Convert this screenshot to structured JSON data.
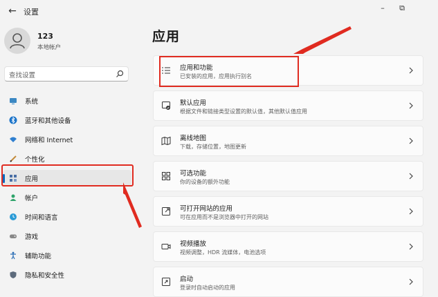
{
  "window": {
    "title": "设置",
    "back_glyph": "←",
    "minimize_glyph": "–",
    "maximize_glyph": "⧉"
  },
  "user": {
    "name": "123",
    "account_type": "本地帐户"
  },
  "search": {
    "placeholder": "查找设置"
  },
  "sidebar": {
    "items": [
      {
        "label": "系统",
        "icon": "monitor-icon",
        "active": false
      },
      {
        "label": "蓝牙和其他设备",
        "icon": "bluetooth-icon",
        "active": false
      },
      {
        "label": "网络和 Internet",
        "icon": "wifi-icon",
        "active": false
      },
      {
        "label": "个性化",
        "icon": "pencil-icon",
        "active": false
      },
      {
        "label": "应用",
        "icon": "apps-icon",
        "active": true
      },
      {
        "label": "帐户",
        "icon": "person-icon",
        "active": false
      },
      {
        "label": "时间和语言",
        "icon": "globe-clock-icon",
        "active": false
      },
      {
        "label": "游戏",
        "icon": "gamepad-icon",
        "active": false
      },
      {
        "label": "辅助功能",
        "icon": "accessibility-icon",
        "active": false
      },
      {
        "label": "隐私和安全性",
        "icon": "shield-icon",
        "active": false
      }
    ]
  },
  "main": {
    "title": "应用",
    "cards": [
      {
        "title": "应用和功能",
        "subtitle": "已安装的应用，应用执行别名",
        "icon": "apps-list-icon"
      },
      {
        "title": "默认应用",
        "subtitle": "根据文件和链接类型设置的默认值，其他默认值应用",
        "icon": "default-app-icon"
      },
      {
        "title": "离线地图",
        "subtitle": "下载，存储位置，地图更新",
        "icon": "map-icon"
      },
      {
        "title": "可选功能",
        "subtitle": "你的设备的额外功能",
        "icon": "optional-features-icon"
      },
      {
        "title": "可打开网站的应用",
        "subtitle": "可在应用而不是浏览器中打开的网站",
        "icon": "open-website-icon"
      },
      {
        "title": "视频播放",
        "subtitle": "视频调整，HDR 流媒体，电池选项",
        "icon": "video-icon"
      },
      {
        "title": "启动",
        "subtitle": "登录时自动启动的应用",
        "icon": "startup-icon"
      }
    ]
  },
  "colors": {
    "accent": "#0067c0",
    "annotation": "#e02b20",
    "background": "#f3f3f3",
    "card": "#fbfbfb"
  }
}
